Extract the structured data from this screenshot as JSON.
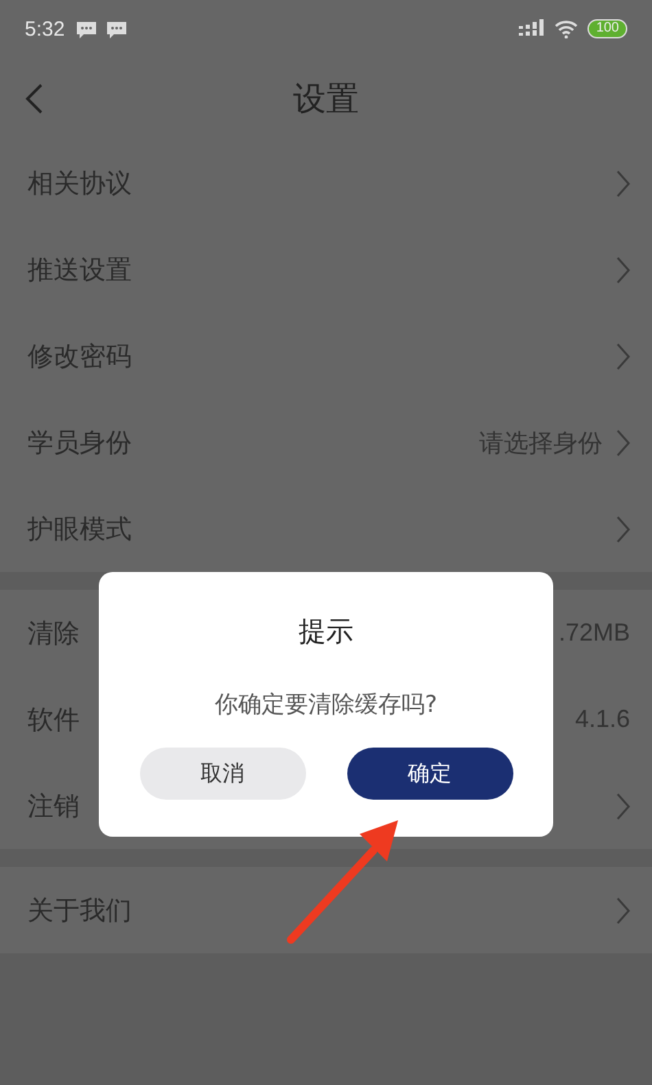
{
  "status_bar": {
    "time": "5:32",
    "battery": "100"
  },
  "header": {
    "title": "设置"
  },
  "groups": [
    {
      "rows": [
        {
          "label": "相关协议",
          "chevron": true
        },
        {
          "label": "推送设置",
          "chevron": true
        },
        {
          "label": "修改密码",
          "chevron": true
        },
        {
          "label": "学员身份",
          "value": "请选择身份",
          "chevron": true
        },
        {
          "label": "护眼模式",
          "chevron": true
        }
      ]
    },
    {
      "rows": [
        {
          "label": "清除",
          "value": ".72MB",
          "chevron": false
        },
        {
          "label": "软件",
          "value": "4.1.6",
          "chevron": false
        },
        {
          "label": "注销",
          "chevron": true
        }
      ]
    },
    {
      "rows": [
        {
          "label": "关于我们",
          "chevron": true
        }
      ]
    }
  ],
  "dialog": {
    "title": "提示",
    "message": "你确定要清除缓存吗?",
    "buttons": [
      {
        "label": "取消",
        "kind": "cancel"
      },
      {
        "label": "确定",
        "kind": "confirm"
      }
    ]
  },
  "annotation": {
    "kind": "arrow"
  }
}
